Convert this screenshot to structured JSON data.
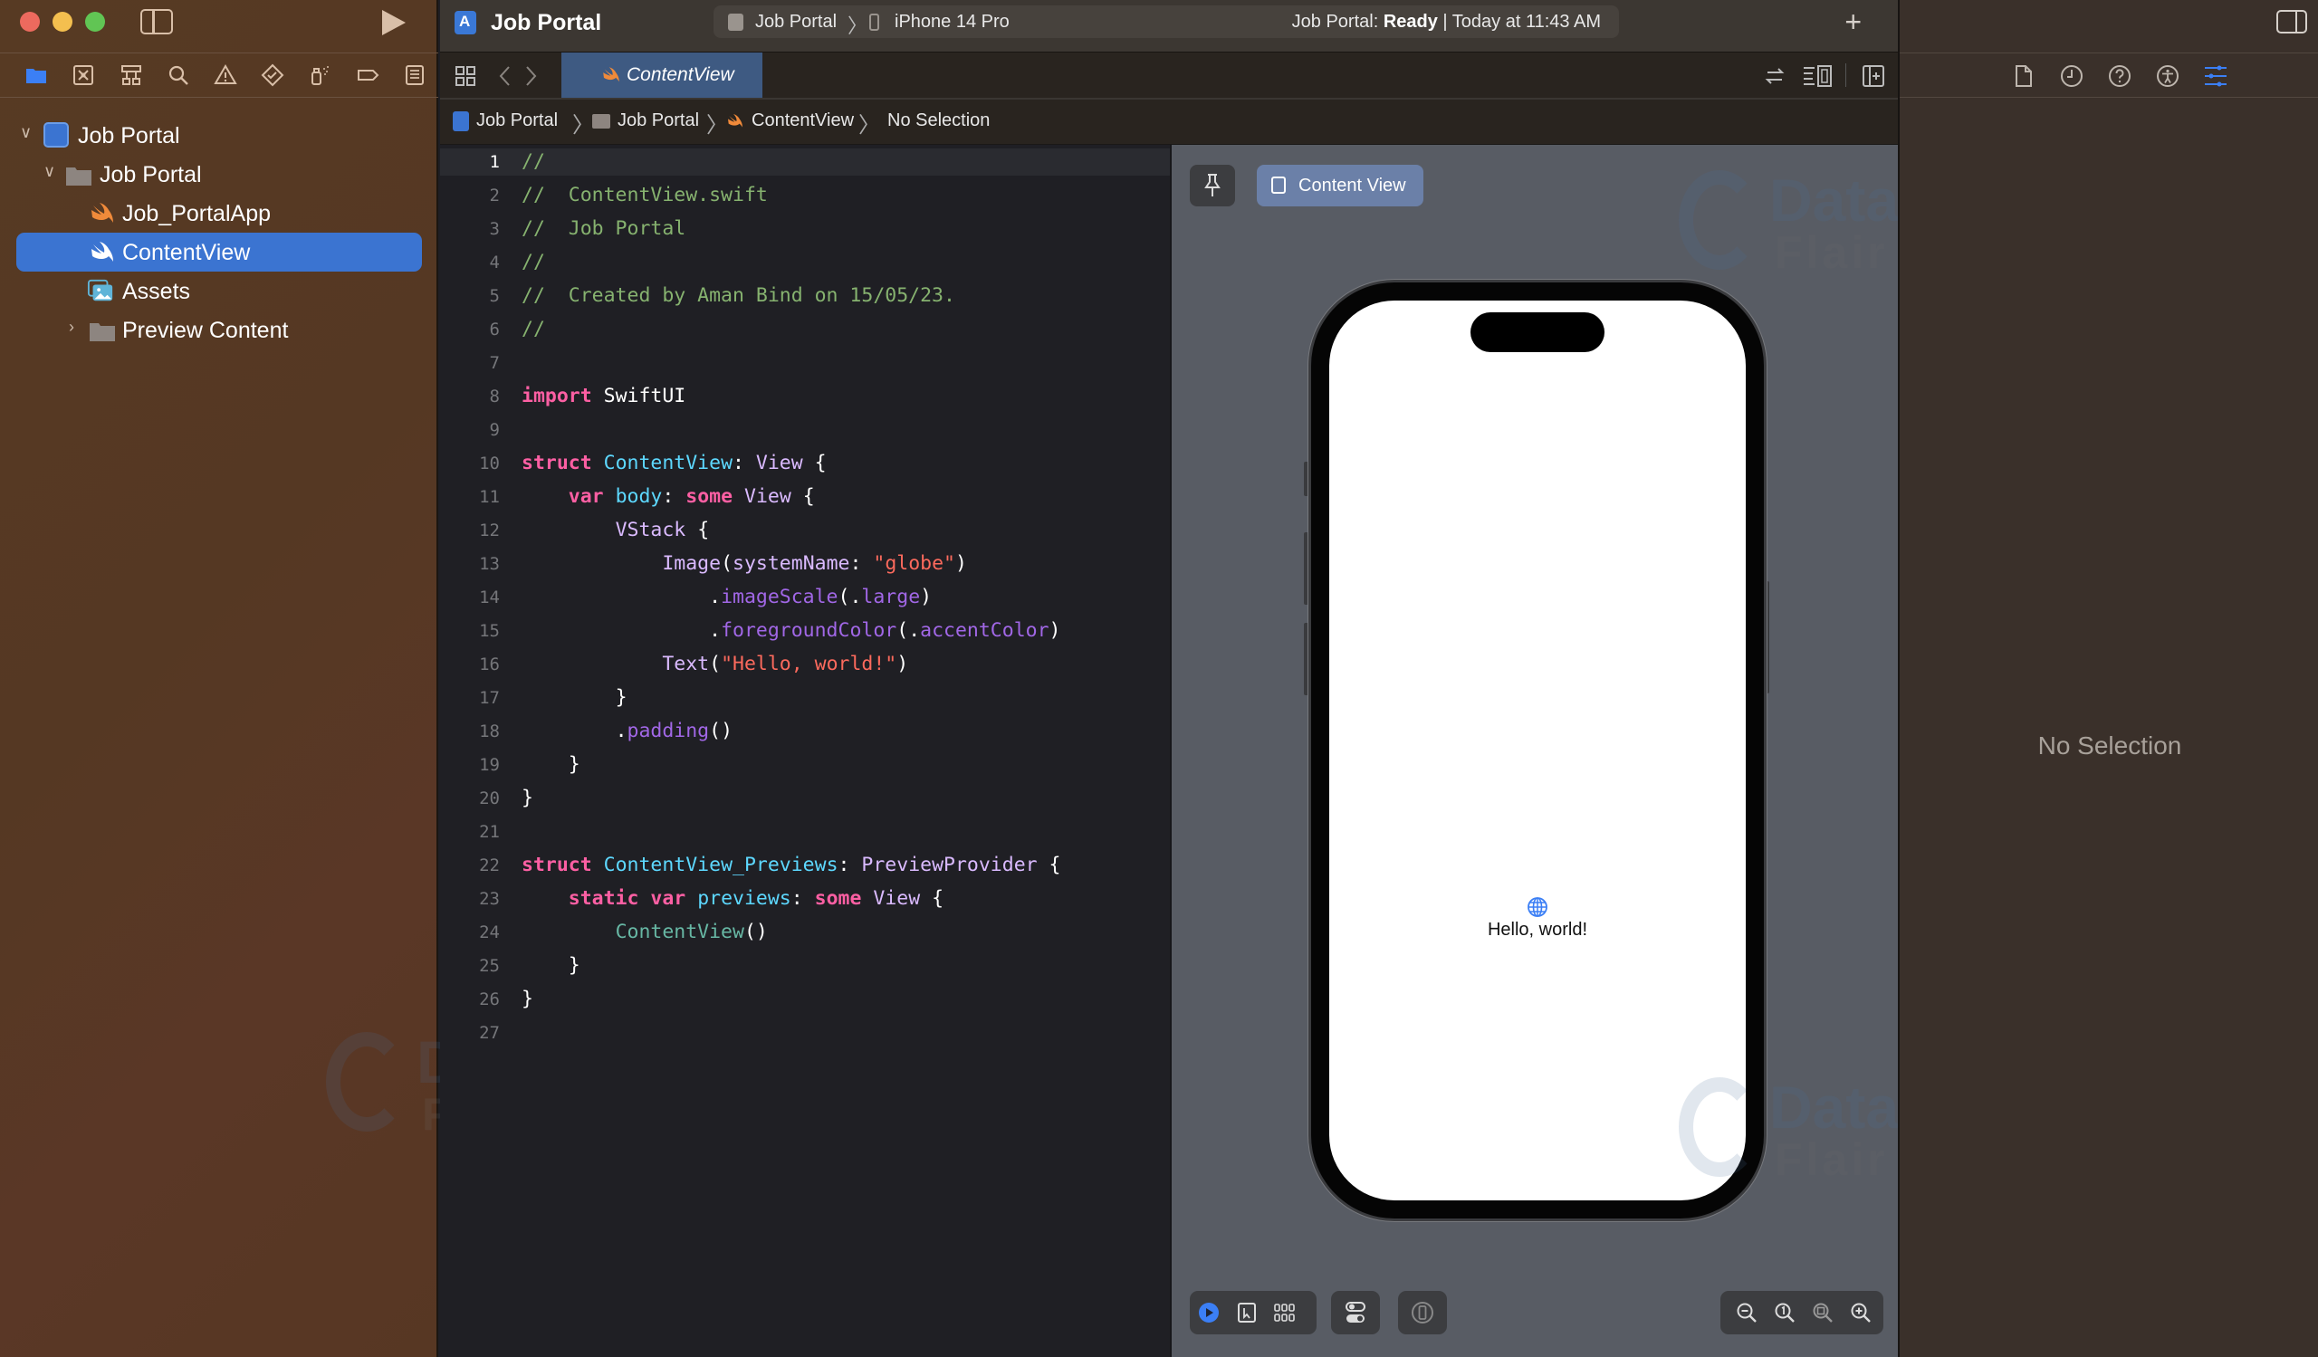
{
  "window": {
    "title": "Job Portal",
    "scheme": {
      "project": "Job Portal",
      "device": "iPhone 14 Pro",
      "status_prefix": "Job Portal: ",
      "status_bold": "Ready",
      "status_suffix": " | Today at 11:43 AM"
    },
    "add_icon": "+"
  },
  "navigator": {
    "tabs": [
      {
        "name": "project-navigator",
        "active": true
      },
      {
        "name": "source-control"
      },
      {
        "name": "symbols"
      },
      {
        "name": "find"
      },
      {
        "name": "issues"
      },
      {
        "name": "tests"
      },
      {
        "name": "debug"
      },
      {
        "name": "breakpoints"
      },
      {
        "name": "reports"
      }
    ],
    "tree": [
      {
        "label": "Job Portal",
        "type": "project",
        "level": 0,
        "expanded": true
      },
      {
        "label": "Job Portal",
        "type": "folder",
        "level": 1,
        "expanded": true
      },
      {
        "label": "Job_PortalApp",
        "type": "swift",
        "level": 2
      },
      {
        "label": "ContentView",
        "type": "swift",
        "level": 2,
        "selected": true
      },
      {
        "label": "Assets",
        "type": "assets",
        "level": 2
      },
      {
        "label": "Preview Content",
        "type": "folder",
        "level": 2,
        "expanded": false
      }
    ]
  },
  "editor": {
    "active_tab": "ContentView",
    "jump_bar": [
      "Job Portal",
      "Job Portal",
      "ContentView",
      "No Selection"
    ],
    "current_line": 1,
    "lines": [
      "//",
      "//  ContentView.swift",
      "//  Job Portal",
      "//",
      "//  Created by Aman Bind on 15/05/23.",
      "//",
      "",
      "import SwiftUI",
      "",
      "struct ContentView: View {",
      "    var body: some View {",
      "        VStack {",
      "            Image(systemName: \"globe\")",
      "                .imageScale(.large)",
      "                .foregroundColor(.accentColor)",
      "            Text(\"Hello, world!\")",
      "        }",
      "        .padding()",
      "    }",
      "}",
      "",
      "struct ContentView_Previews: PreviewProvider {",
      "    static var previews: some View {",
      "        ContentView()",
      "    }",
      "}",
      ""
    ]
  },
  "canvas": {
    "preview_button": "Content View",
    "preview_text": "Hello, world!",
    "preview_icon": "globe-icon",
    "bottom_left_controls": [
      "live-mode",
      "selectable-mode",
      "variants"
    ],
    "bottom_right_controls": [
      "zoom-out",
      "zoom-100",
      "zoom-fit",
      "zoom-in"
    ]
  },
  "inspector": {
    "tabs": [
      "file-inspector",
      "history-inspector",
      "quick-help",
      "accessibility-inspector",
      "attributes-inspector"
    ],
    "active_tab": "attributes-inspector",
    "empty_text": "No Selection"
  },
  "watermark": {
    "line1": "Data",
    "line2": "Flair"
  },
  "colors": {
    "accent": "#3b74d1",
    "swift_orange": "#f08a3a",
    "comment": "#86b26f",
    "keyword": "#fc5fa3",
    "string": "#fc6a5d"
  }
}
